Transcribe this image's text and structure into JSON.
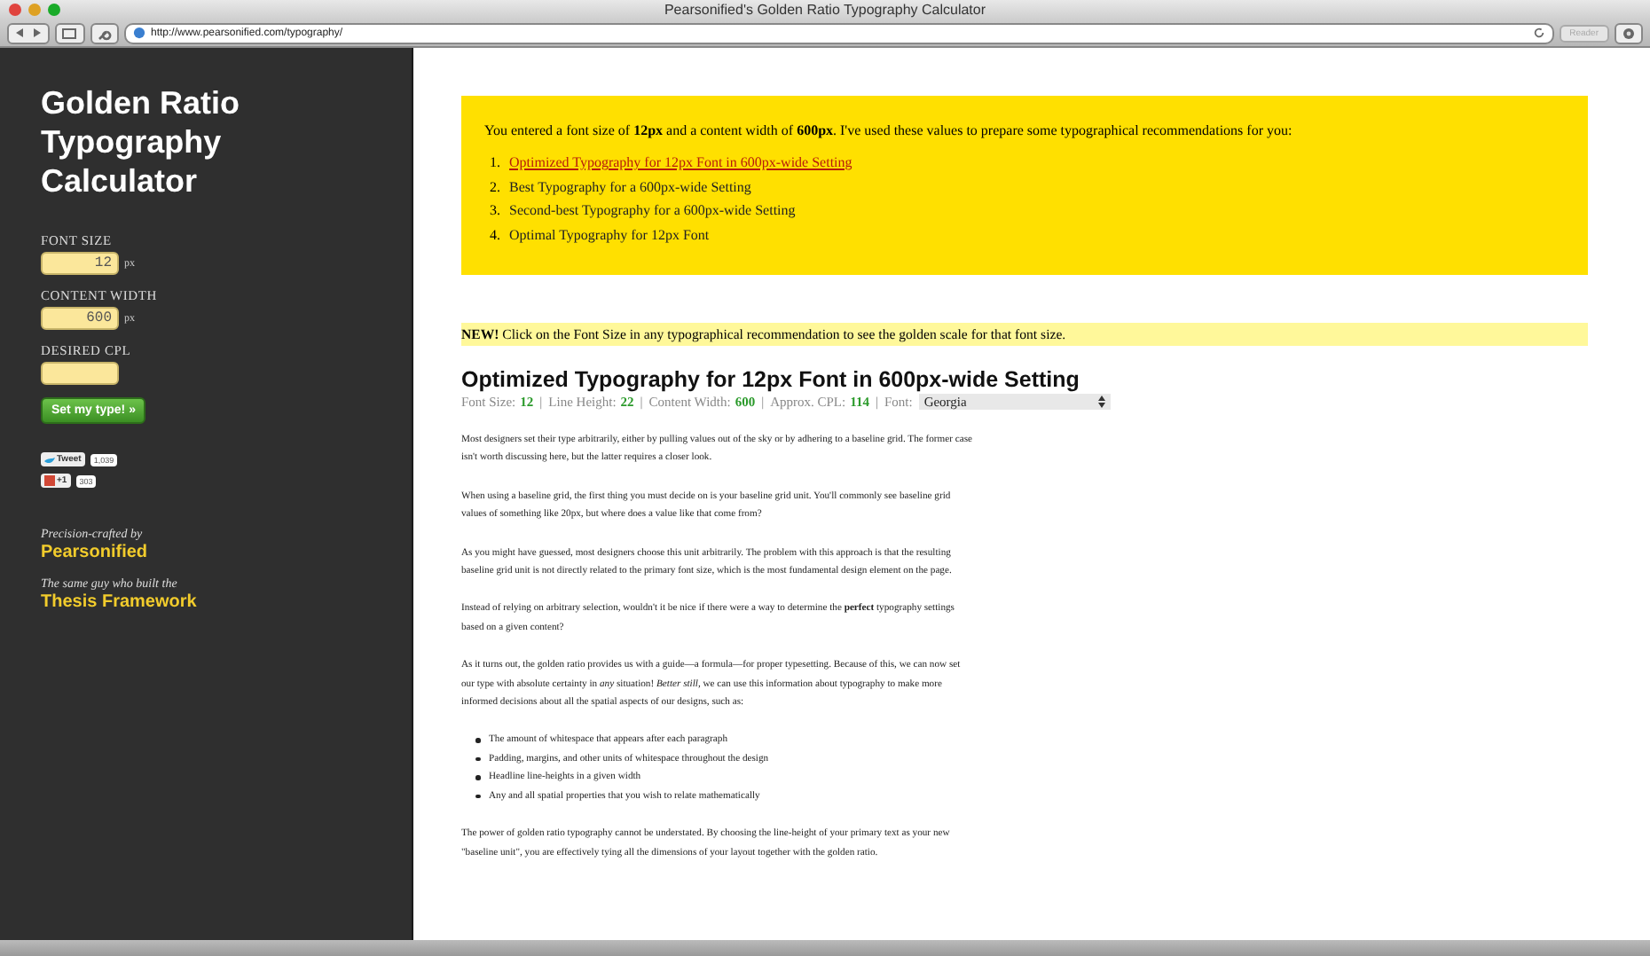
{
  "window": {
    "title": "Pearsonified's Golden Ratio Typography Calculator"
  },
  "toolbar": {
    "url": "http://www.pearsonified.com/typography/",
    "reader_button": "Reader"
  },
  "sidebar": {
    "title": "Golden Ratio Typography Calculator",
    "fields": [
      {
        "label": "FONT SIZE",
        "value": "12",
        "unit": "px"
      },
      {
        "label": "CONTENT WIDTH",
        "value": "600",
        "unit": "px"
      },
      {
        "label": "DESIRED CPL"
      }
    ],
    "submit": "Set my type! »",
    "social": [
      {
        "kind": "tweet",
        "label": "Tweet",
        "count": "1,039"
      },
      {
        "kind": "gplus",
        "label": "+1",
        "count": "303"
      }
    ],
    "credits": [
      {
        "intro": "Precision-crafted by",
        "link": "Pearsonified"
      },
      {
        "intro": "The same guy who built the",
        "link": "Thesis Framework"
      }
    ]
  },
  "summary": {
    "text": "You entered a font size of **12px** and a content width of **600px**. I've used these values to prepare some typographical recommendations for you:",
    "items": [
      {
        "number": "1.",
        "label": "Optimized Typography for 12px Font in 600px-wide Setting",
        "selected": true
      },
      {
        "number": "2.",
        "label": "Best Typography for a 600px-wide Setting",
        "selected": false
      },
      {
        "number": "3.",
        "label": "Second-best Typography for a 600px-wide Setting",
        "selected": false
      },
      {
        "number": "4.",
        "label": "Optimal Typography for 12px Font",
        "selected": false
      }
    ]
  },
  "notice": "**NEW!** Click on the Font Size in any typographical recommendation to see the golden scale for that font size.",
  "section": {
    "heading": "Optimized Typography for 12px Font in 600px-wide Setting",
    "stats": [
      {
        "label": "Font Size:",
        "value": "12"
      },
      {
        "label": "Line Height:",
        "value": "22"
      },
      {
        "label": "Content Width:",
        "value": "600"
      },
      {
        "label": "Approx. CPL:",
        "value": "114"
      }
    ],
    "separator": "|",
    "font_label": "Font:",
    "font_select": "Georgia",
    "blocks": [
      {
        "kind": "p",
        "text": "Most designers set their type arbitrarily, either by pulling values out of the sky or by adhering to a baseline grid. The former case isn't worth discussing here, but the latter requires a closer look."
      },
      {
        "kind": "p",
        "text": "When using a baseline grid, the first thing you must decide on is your baseline grid unit. You'll commonly see baseline grid values of something like 20px, but where does a value like that come from?"
      },
      {
        "kind": "p",
        "text": "As you might have guessed, most designers choose this unit arbitrarily. The problem with this approach is that the resulting baseline grid unit is not directly related to the primary font size, which is the most fundamental design element on the page."
      },
      {
        "kind": "p",
        "text": "Instead of relying on arbitrary selection, wouldn't it be nice if there were a way to determine the **perfect** typography settings based on a given content?"
      },
      {
        "kind": "p",
        "text": "As it turns out, the golden ratio provides us with a guide—a formula—for proper typesetting. Because of this, we can now set our type with absolute certainty in *any* situation! *Better still*, we can use this information about typography to make more informed decisions about all the spatial aspects of our designs, such as:"
      },
      {
        "kind": "ul",
        "items": [
          "The amount of whitespace that appears after each paragraph",
          "Padding, margins, and other units of whitespace throughout the design",
          "Headline line-heights in a given width",
          "Any and all spatial properties that you wish to relate mathematically"
        ]
      },
      {
        "kind": "p",
        "text": "The power of golden ratio typography cannot be understated. By choosing the line-height of your primary text as your new \"baseline unit\", you are effectively tying all the dimensions of your layout together with the golden ratio."
      }
    ]
  }
}
